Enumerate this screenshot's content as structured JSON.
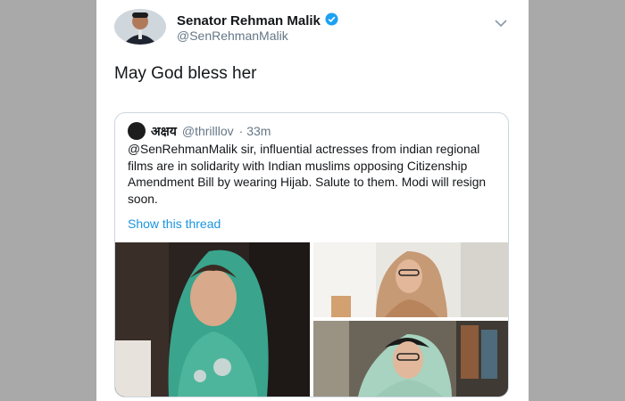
{
  "tweet": {
    "author_name": "Senator Rehman Malik",
    "author_handle": "@SenRehmanMalik",
    "text": "May God bless her",
    "icons": {
      "verified": "verified-badge-icon",
      "more": "chevron-down-icon"
    },
    "colors": {
      "verified": "#1da1f2",
      "link": "#1b95e0"
    }
  },
  "quoted_tweet": {
    "author_name": "अक्षय",
    "author_handle": "@thrilllov",
    "time": "· 33m",
    "text": "@SenRehmanMalik sir, influential actresses from indian regional films are in solidarity with Indian muslims opposing Citizenship Amendment Bill by wearing Hijab. Salute to them. Modi will resign soon.",
    "show_thread": "Show this thread"
  }
}
